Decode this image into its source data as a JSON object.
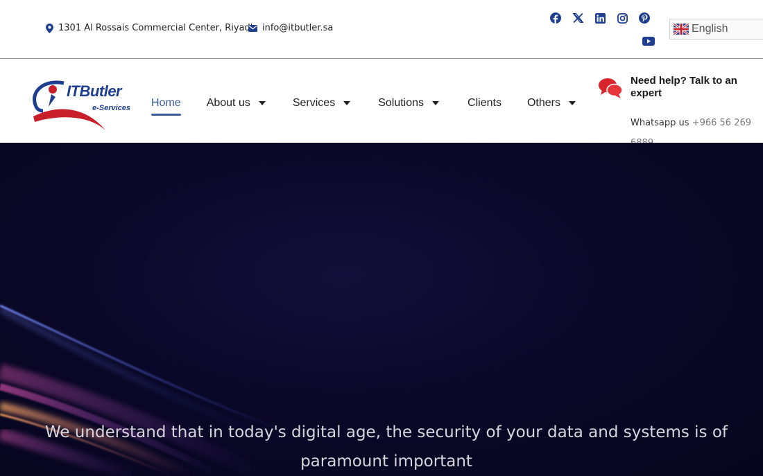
{
  "topbar": {
    "address": "1301 Al Rossais Commercial Center, Riyadh",
    "email": "info@itbutler.sa",
    "socials": [
      "facebook-icon",
      "x-twitter-icon",
      "linkedin-icon",
      "instagram-icon",
      "pinterest-icon",
      "youtube-icon"
    ],
    "language": "English"
  },
  "brand": {
    "name": "ITButler",
    "tagline": "e-Services"
  },
  "nav": {
    "items": [
      {
        "label": "Home",
        "active": true,
        "dropdown": false
      },
      {
        "label": "About us",
        "dropdown": true
      },
      {
        "label": "Services",
        "dropdown": true
      },
      {
        "label": "Solutions",
        "dropdown": true
      },
      {
        "label": "Clients",
        "dropdown": false
      },
      {
        "label": "Others",
        "dropdown": true
      }
    ]
  },
  "help": {
    "title": "Need help? Talk to an expert",
    "whatsapp_label": "Whatsapp us",
    "whatsapp_number": "+966 56 269 6889"
  },
  "hero": {
    "text": "We understand that in today's digital age, the security of your data and systems is of paramount important"
  },
  "colors": {
    "brand_blue": "#1e3f8f",
    "brand_red": "#c8202a",
    "nav_active": "#3a5a9e",
    "hero_bg": "#0a0828"
  }
}
